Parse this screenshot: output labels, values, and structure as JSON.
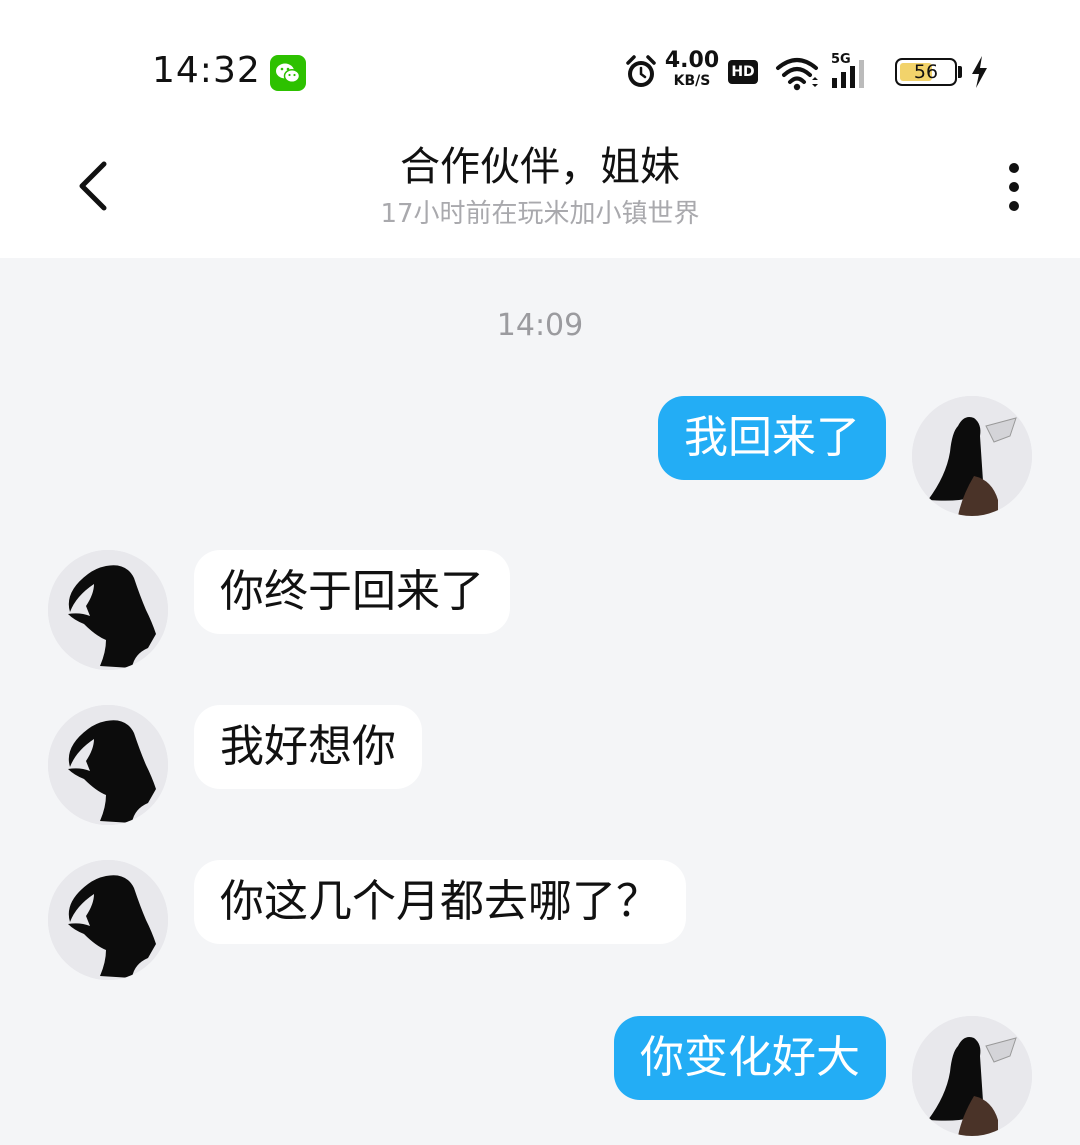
{
  "status_bar": {
    "time": "14:32",
    "net_speed_value": "4.00",
    "net_speed_unit": "KB/S",
    "hd_label": "HD",
    "network_type": "5G",
    "battery_level": "56",
    "icons": [
      "wechat-icon",
      "alarm-icon",
      "wifi-icon",
      "signal-icon",
      "battery-icon",
      "charging-bolt-icon"
    ]
  },
  "header": {
    "title": "合作伙伴，姐妹",
    "subtitle": "17小时前在玩米加小镇世界",
    "back_icon": "chevron-left-icon",
    "more_icon": "more-vertical-icon"
  },
  "timestamp": "14:09",
  "messages": [
    {
      "from": "me",
      "text": "我回来了"
    },
    {
      "from": "them",
      "text": "你终于回来了"
    },
    {
      "from": "them",
      "text": "我好想你"
    },
    {
      "from": "them",
      "text": "你这几个月都去哪了？"
    },
    {
      "from": "me",
      "text": "你变化好大"
    }
  ],
  "colors": {
    "outgoing_bubble": "#23adf5",
    "incoming_bubble": "#ffffff",
    "chat_background": "#f4f5f7",
    "header_background": "#ffffff",
    "battery_fill": "#f2d36b",
    "wechat_green": "#2dc100"
  }
}
